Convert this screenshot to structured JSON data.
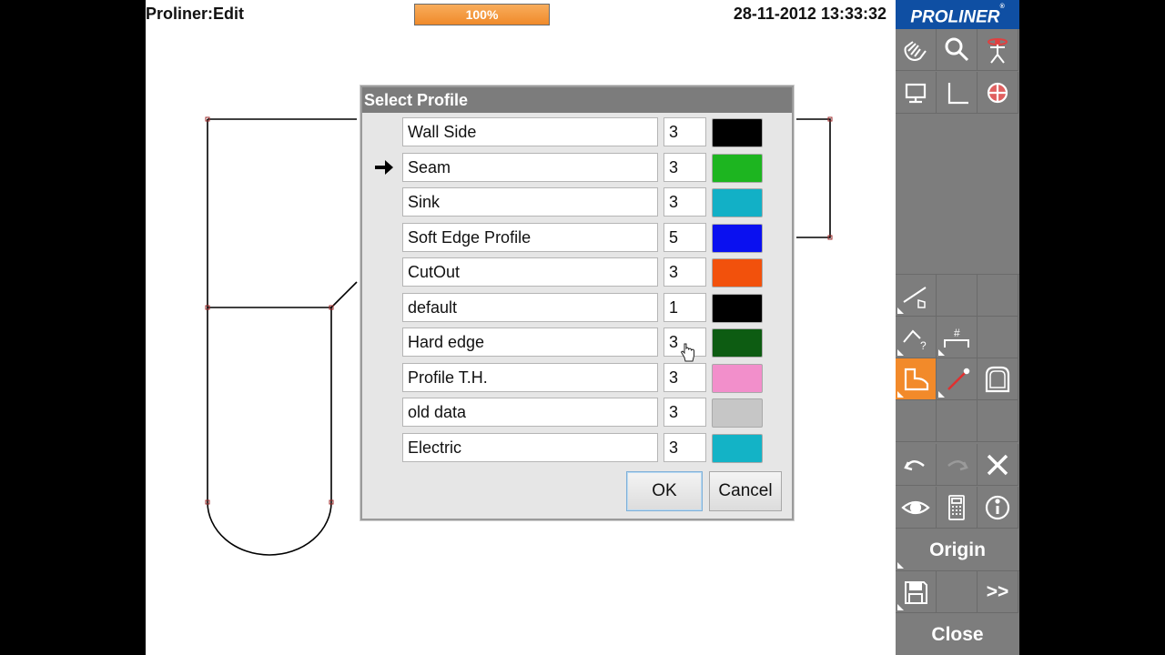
{
  "header": {
    "app_title": "Proliner:Edit",
    "progress_text": "100%",
    "progress_value": 1.0,
    "datetime": "28-11-2012 13:33:32"
  },
  "brand": {
    "logo_text": "PROLINER",
    "logo_mark": "®"
  },
  "dialog": {
    "title": "Select Profile",
    "selected_index": 1,
    "profiles": [
      {
        "name": "Wall Side",
        "value": "3",
        "color": "#000000"
      },
      {
        "name": "Seam",
        "value": "3",
        "color": "#1db520"
      },
      {
        "name": "Sink",
        "value": "3",
        "color": "#12b0c6"
      },
      {
        "name": "Soft Edge Profile",
        "value": "5",
        "color": "#0a10f0"
      },
      {
        "name": "CutOut",
        "value": "3",
        "color": "#f2510c"
      },
      {
        "name": "default",
        "value": "1",
        "color": "#000000"
      },
      {
        "name": "Hard edge",
        "value": "3",
        "color": "#0d5c12"
      },
      {
        "name": "Profile T.H.",
        "value": "3",
        "color": "#f28fcb"
      },
      {
        "name": "old data",
        "value": "3",
        "color": "#c6c6c6"
      },
      {
        "name": "Electric",
        "value": "3",
        "color": "#13b3c6"
      }
    ],
    "ok_label": "OK",
    "cancel_label": "Cancel"
  },
  "panel": {
    "origin_label": "Origin",
    "more_label": ">>",
    "close_label": "Close",
    "tools": [
      "pan-hand-icon",
      "zoom-icon",
      "person-icon",
      "monitor-icon",
      "axis-corner-icon",
      "target-icon",
      "line-touch-icon",
      "edge-question-icon",
      "dimension-hash-icon",
      "profile-shape-icon",
      "red-line-icon",
      "rounded-shape-icon",
      "undo-icon",
      "redo-icon",
      "delete-x-icon",
      "eye-icon",
      "calculator-icon",
      "info-icon",
      "save-disk-icon"
    ],
    "accent": "#f28a2a"
  }
}
